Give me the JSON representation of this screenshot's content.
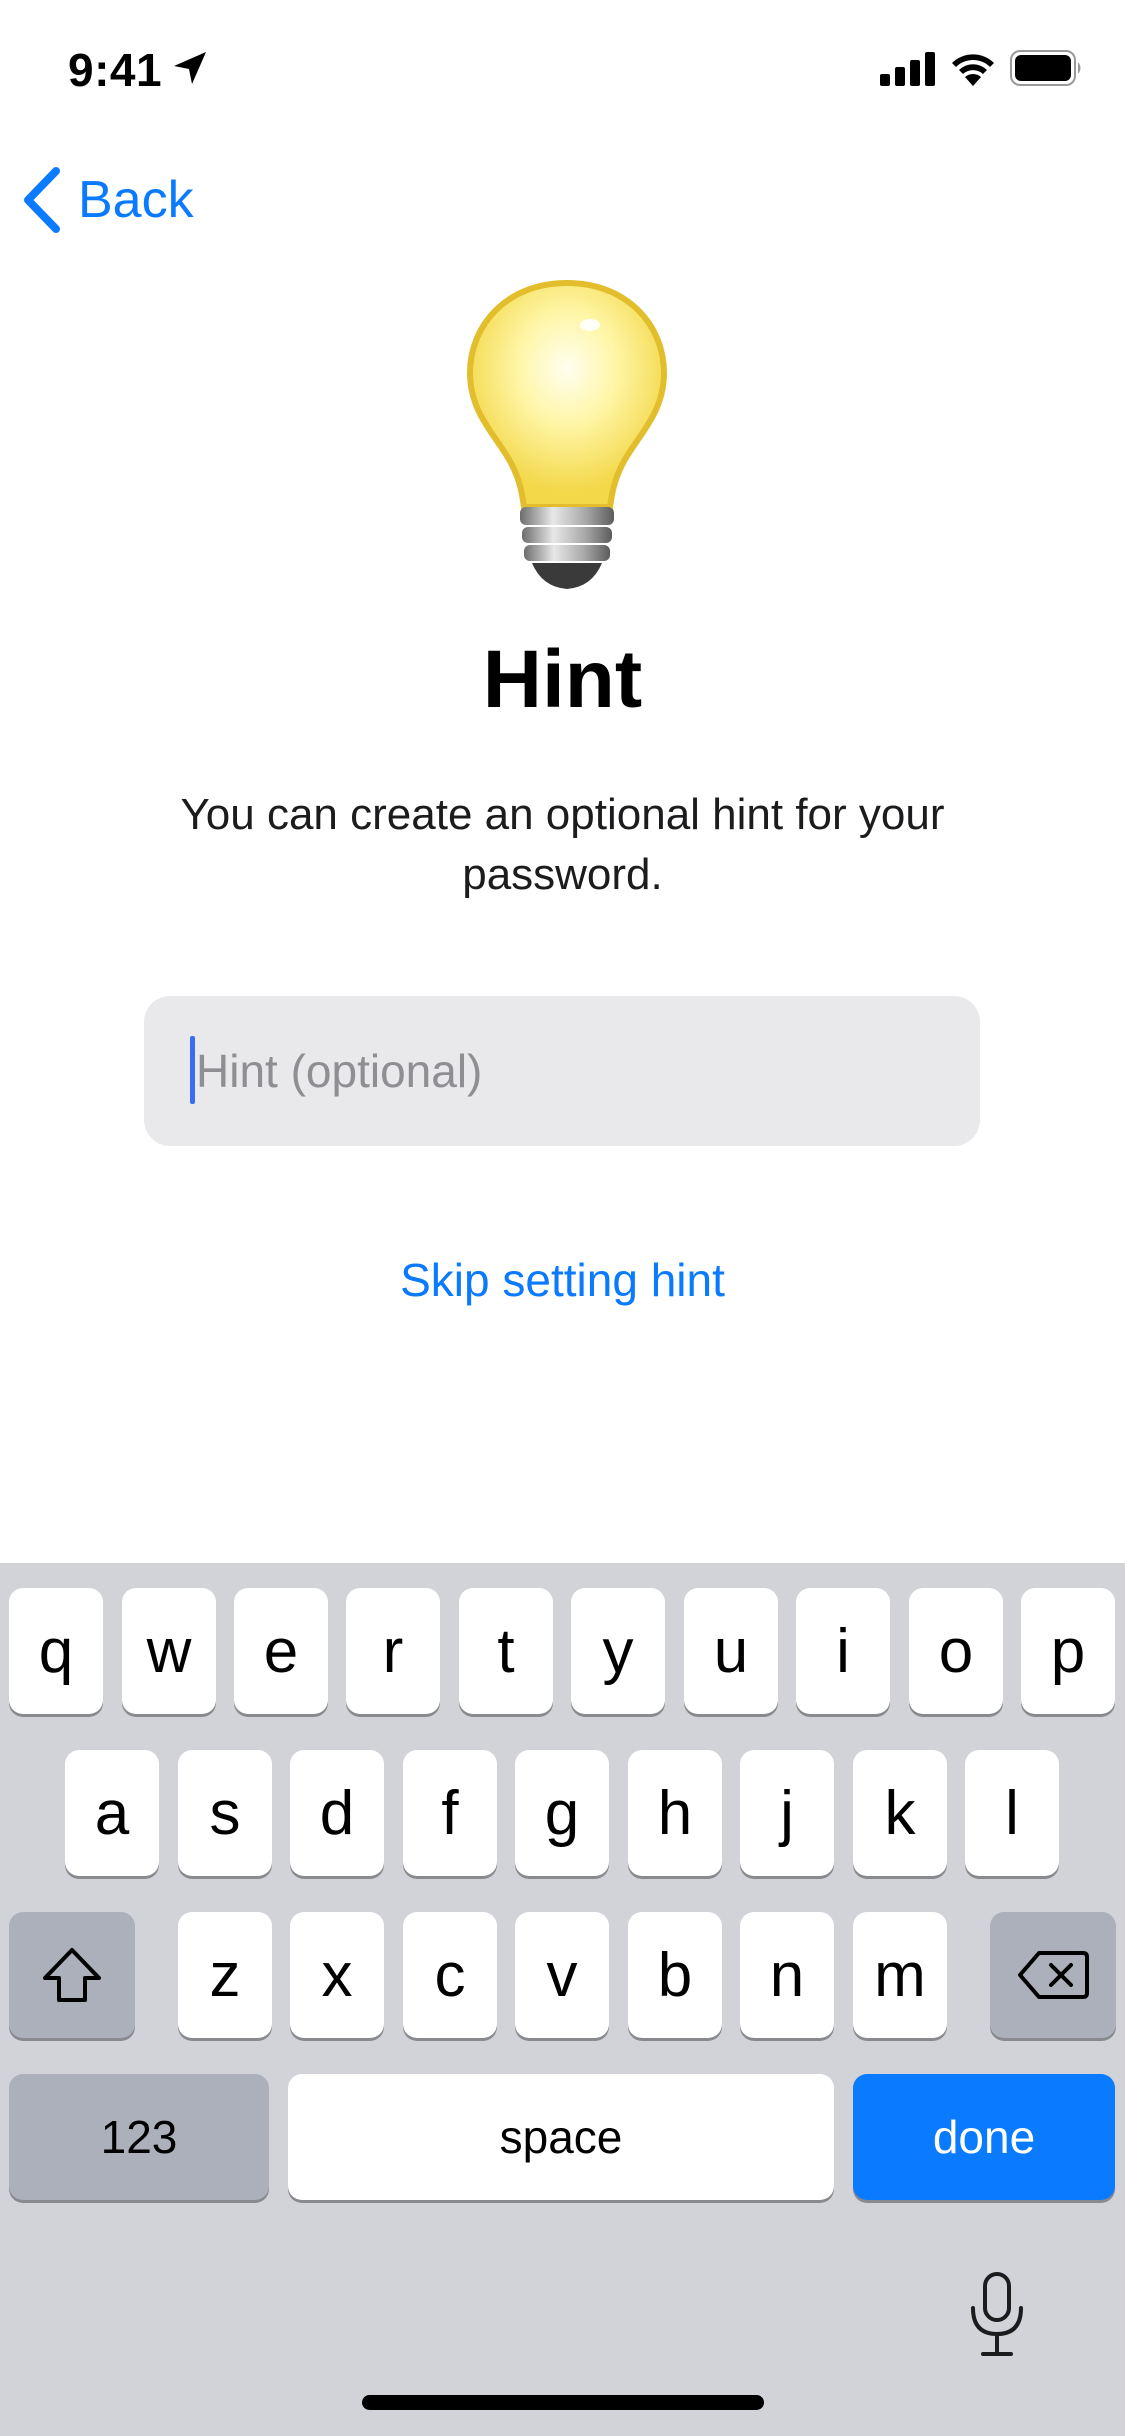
{
  "status_bar": {
    "time": "9:41",
    "icons": [
      "location-arrow-icon",
      "cellular-signal-icon",
      "wifi-icon",
      "battery-icon"
    ]
  },
  "nav": {
    "back_label": "Back"
  },
  "content": {
    "icon": "light-bulb-icon",
    "title": "Hint",
    "description": "You can create an optional hint for your password.",
    "hint_placeholder": "Hint (optional)",
    "hint_value": "",
    "skip_label": "Skip setting hint"
  },
  "keyboard": {
    "row1": [
      "q",
      "w",
      "e",
      "r",
      "t",
      "y",
      "u",
      "i",
      "o",
      "p"
    ],
    "row2": [
      "a",
      "s",
      "d",
      "f",
      "g",
      "h",
      "j",
      "k",
      "l"
    ],
    "row3": [
      "z",
      "x",
      "c",
      "v",
      "b",
      "n",
      "m"
    ],
    "numbers_label": "123",
    "space_label": "space",
    "done_label": "done",
    "shift_icon": "shift-icon",
    "delete_icon": "delete-icon",
    "dictation_icon": "microphone-icon"
  },
  "colors": {
    "accent": "#0a7aff",
    "field_background": "#e9e9eb",
    "keyboard_background": "#d1d3d9",
    "dark_key": "#abb0bb"
  }
}
